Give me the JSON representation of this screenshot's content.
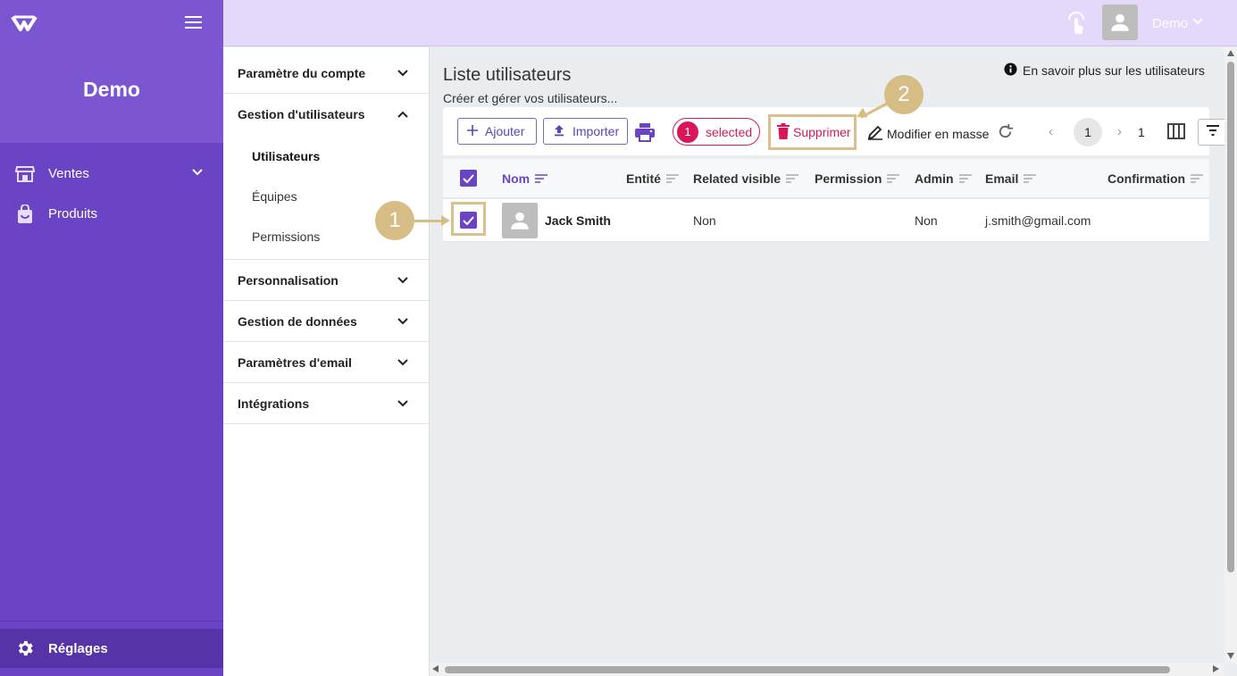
{
  "sidebar": {
    "org_name": "Demo",
    "items": [
      {
        "label": "Ventes",
        "icon": "store-icon",
        "expandable": true
      },
      {
        "label": "Produits",
        "icon": "shopping-bag-icon",
        "expandable": false
      }
    ],
    "settings_label": "Réglages"
  },
  "header": {
    "user_name": "Demo"
  },
  "submenu": {
    "sections": [
      {
        "label": "Paramètre du compte",
        "expanded": false
      },
      {
        "label": "Gestion d'utilisateurs",
        "expanded": true
      },
      {
        "label": "Personnalisation",
        "expanded": false
      },
      {
        "label": "Gestion de données",
        "expanded": false
      },
      {
        "label": "Paramètres d'email",
        "expanded": false
      },
      {
        "label": "Intégrations",
        "expanded": false
      }
    ],
    "children": [
      {
        "label": "Utilisateurs",
        "active": true
      },
      {
        "label": "Équipes",
        "active": false
      },
      {
        "label": "Permissions",
        "active": false
      }
    ]
  },
  "main": {
    "title": "Liste utilisateurs",
    "subtitle": "Créer et gérer vos utilisateurs...",
    "learn_more": "En savoir plus sur les utilisateurs",
    "toolbar": {
      "add_label": "Ajouter",
      "import_label": "Importer",
      "selected_count": "1",
      "selected_label": "selected",
      "delete_label": "Supprimer",
      "mass_edit_label": "Modifier en masse",
      "current_page": "1",
      "total_pages": "1"
    },
    "table": {
      "columns": [
        "Nom",
        "Entité",
        "Related visible",
        "Permission",
        "Admin",
        "Email",
        "Confirmation"
      ],
      "rows": [
        {
          "name": "Jack Smith",
          "entity": "",
          "related_visible": "Non",
          "permission": "",
          "admin": "Non",
          "email": "j.smith@gmail.com",
          "confirmation": "",
          "selected": true
        }
      ]
    }
  },
  "annotations": {
    "step1": "1",
    "step2": "2"
  },
  "colors": {
    "sidebar": "#6a44c4",
    "accent": "#6a44c4",
    "danger": "#d8175b",
    "highlight": "#d6bd86"
  }
}
